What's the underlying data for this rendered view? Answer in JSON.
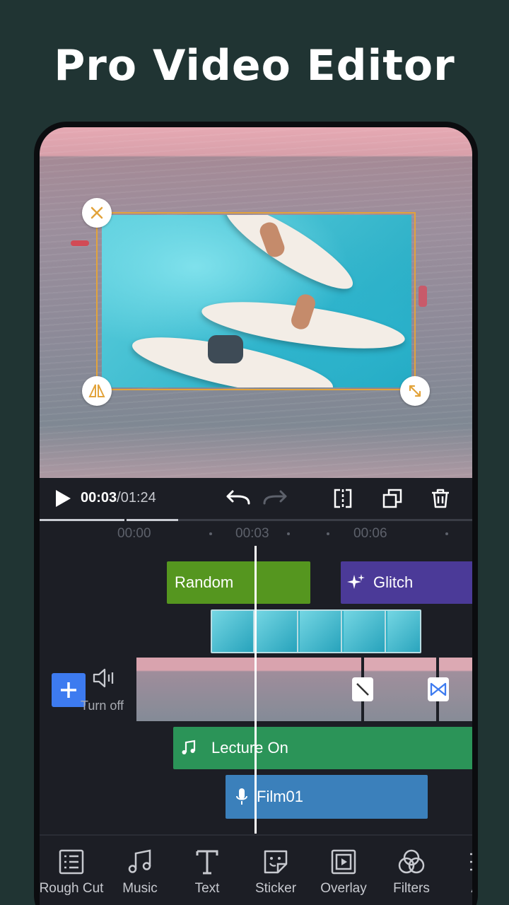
{
  "headline": "Pro Video Editor",
  "player": {
    "current_time": "00:03",
    "total_time": "/01:24",
    "progress_fraction": 0.32
  },
  "ruler": {
    "labels": [
      "00:00",
      "00:03",
      "00:06"
    ]
  },
  "timeline": {
    "effect_random_label": "Random",
    "effect_glitch_label": "Glitch",
    "audio_turn_off_label": "Turn off",
    "music_track_label": "Lecture On",
    "voice_track_label": "Film01"
  },
  "toolbar": {
    "items": [
      {
        "label": "Rough Cut",
        "icon": "rough-cut-icon"
      },
      {
        "label": "Music",
        "icon": "music-icon"
      },
      {
        "label": "Text",
        "icon": "text-icon"
      },
      {
        "label": "Sticker",
        "icon": "sticker-icon"
      },
      {
        "label": "Overlay",
        "icon": "overlay-icon"
      },
      {
        "label": "Filters",
        "icon": "filters-icon"
      },
      {
        "label": "Ad",
        "icon": "adjust-icon"
      }
    ]
  },
  "colors": {
    "background": "#203433",
    "effect_random": "#55961f",
    "effect_glitch": "#4b3a98",
    "music_track": "#2b9458",
    "voice_track": "#3b80bb",
    "add_button": "#3d7bf0",
    "selection_frame": "#e2a33b"
  }
}
